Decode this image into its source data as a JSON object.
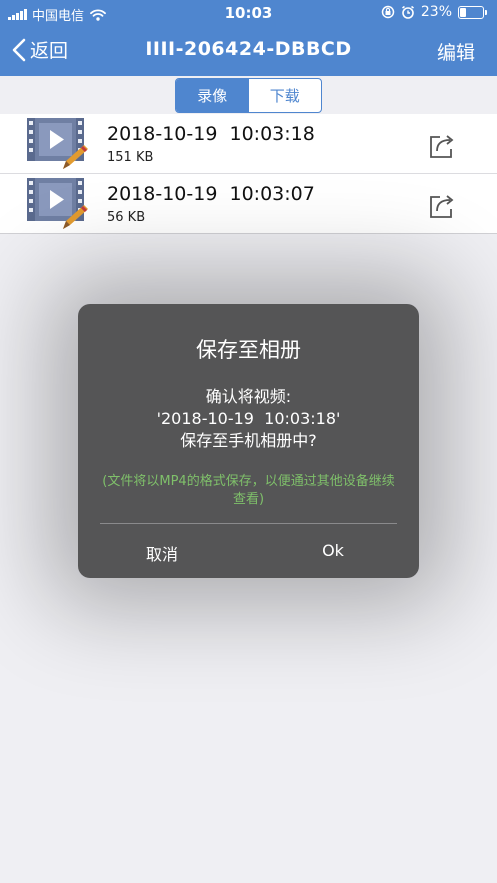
{
  "status_bar": {
    "carrier": "中国电信",
    "time": "10:03",
    "battery_percent": "23%",
    "battery_level": 0.23,
    "icons": [
      "signal-icon",
      "wifi-icon",
      "orientation-lock-icon",
      "alarm-icon",
      "battery-icon"
    ]
  },
  "nav": {
    "back_label": "返回",
    "title": "IIII-206424-DBBCD",
    "edit_label": "编辑"
  },
  "segment": {
    "tabs": [
      {
        "label": "录像",
        "active": true
      },
      {
        "label": "下载",
        "active": false
      }
    ]
  },
  "recordings": [
    {
      "title": "2018-10-19  10:03:18",
      "size": "151 KB"
    },
    {
      "title": "2018-10-19  10:03:07",
      "size": "56 KB"
    }
  ],
  "dialog": {
    "title": "保存至相册",
    "message": "确认将视频:\n'2018-10-19  10:03:18'\n保存至手机相册中?",
    "note": "(文件将以MP4的格式保存，以便通过其他设备继续查看)",
    "cancel_label": "取消",
    "ok_label": "Ok"
  },
  "colors": {
    "header": "#4f86cf",
    "dialog_bg": "#555556",
    "note_green": "#7fc06a",
    "video_icon": "#6f7fa3",
    "pencil": "#e29b2f"
  }
}
